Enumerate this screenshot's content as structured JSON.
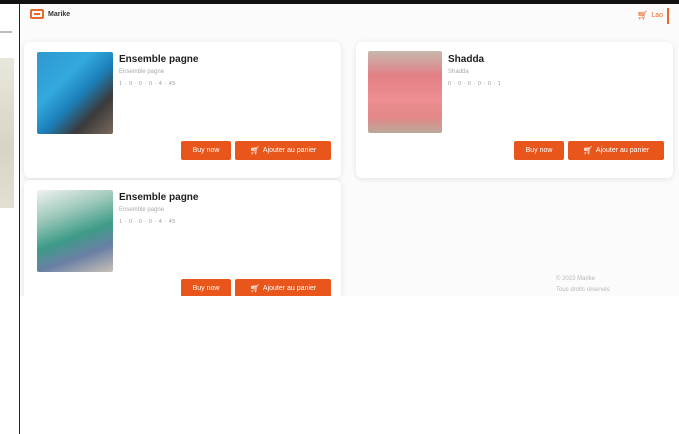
{
  "app": {
    "logo_text": "Marike"
  },
  "header": {
    "cart_label": "Lao",
    "cart_icon": "cart-icon"
  },
  "products": [
    {
      "title": "Ensemble pagne",
      "subtitle": "Ensemble pagne",
      "meta": "1 · 0 · 0 · 0 · 4 · 45",
      "buy_label": "Buy now",
      "add_label": "Ajouter au panier"
    },
    {
      "title": "Shadda",
      "subtitle": "Shadda",
      "meta": "0 · 0 · 0 · 0 · 0 · 1",
      "buy_label": "Buy now",
      "add_label": "Ajouter au panier"
    },
    {
      "title": "Ensemble pagne",
      "subtitle": "Ensemble pagne",
      "meta": "1 · 0 · 0 · 0 · 4 · 45",
      "buy_label": "Buy now",
      "add_label": "Ajouter au panier"
    }
  ],
  "footer": {
    "line1": "© 2023 Marike",
    "line2": "Tous droits réservés"
  },
  "colors": {
    "accent": "#e8561c",
    "brand": "#e8692b"
  }
}
